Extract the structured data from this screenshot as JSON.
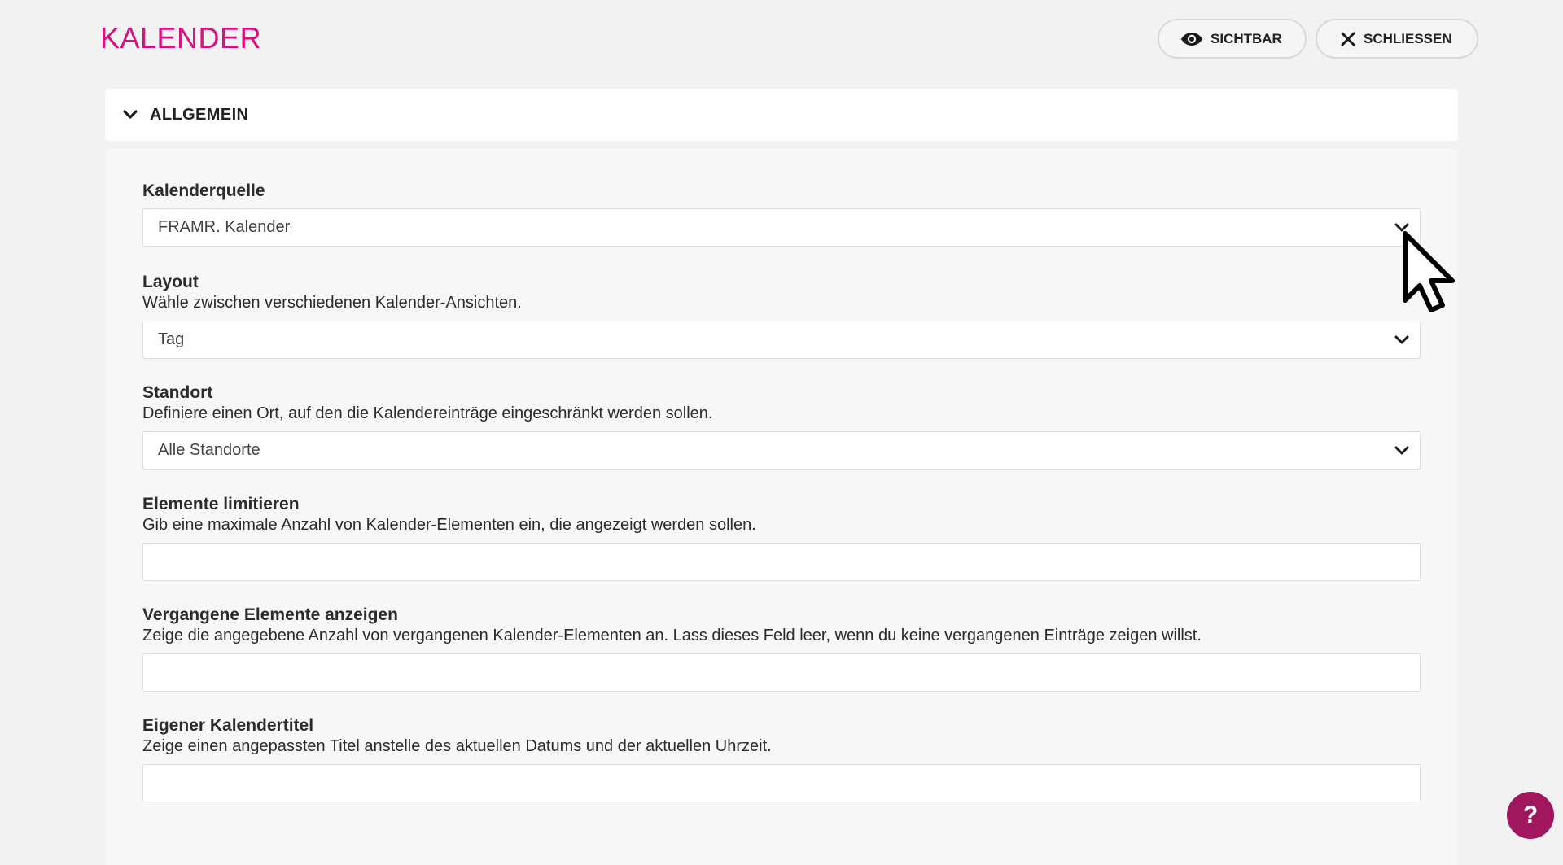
{
  "header": {
    "title": "KALENDER",
    "visible_label": "SICHTBAR",
    "close_label": "SCHLIESSEN",
    "visible_icon": "eye-icon",
    "close_icon": "close-icon"
  },
  "section": {
    "title": "ALLGEMEIN",
    "expanded": true,
    "icon": "chevron-down-icon"
  },
  "fields": {
    "calendar_source": {
      "label": "Kalenderquelle",
      "value": "FRAMR. Kalender"
    },
    "layout": {
      "label": "Layout",
      "description": "Wähle zwischen verschiedenen Kalender-Ansichten.",
      "value": "Tag"
    },
    "location": {
      "label": "Standort",
      "description": "Definiere einen Ort, auf den die Kalendereinträge eingeschränkt werden sollen.",
      "value": "Alle Standorte"
    },
    "limit": {
      "label": "Elemente limitieren",
      "description": "Gib eine maximale Anzahl von Kalender-Elementen ein, die angezeigt werden sollen.",
      "value": ""
    },
    "past": {
      "label": "Vergangene Elemente anzeigen",
      "description": "Zeige die angegebene Anzahl von vergangenen Kalender-Elementen an. Lass dieses Feld leer, wenn du keine vergangenen Einträge zeigen willst.",
      "value": ""
    },
    "custom_title": {
      "label": "Eigener Kalendertitel",
      "description": "Zeige einen angepassten Titel anstelle des aktuellen Datums und der aktuellen Uhrzeit.",
      "value": ""
    }
  },
  "help": {
    "label": "?",
    "icon": "help-icon"
  },
  "colors": {
    "brand": "#d3137f",
    "help_button": "#a0175f",
    "background": "#f2f2f2"
  }
}
